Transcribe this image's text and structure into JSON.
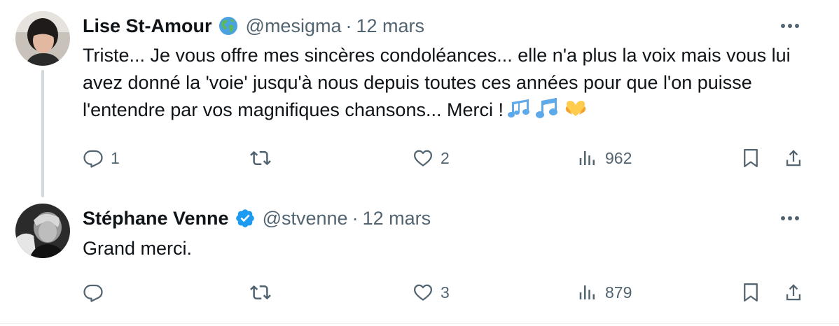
{
  "tweets": [
    {
      "name": "Lise St-Amour",
      "handle": "@mesigma",
      "separator": "·",
      "date": "12 mars",
      "text": "Triste... Je vous offre mes sincères condoléances... elle n'a plus la voix mais vous lui avez donné la 'voie' jusqu'à nous depuis toutes ces années pour que l'on puisse l'entendre par vos magnifiques chansons... Merci !",
      "emojis": [
        "notes-icon",
        "music-note-icon",
        "heart-hands-icon"
      ],
      "badge_icon": "globe-americas-icon",
      "reply_count": "1",
      "retweet_count": "",
      "like_count": "2",
      "view_count": "962"
    },
    {
      "name": "Stéphane Venne",
      "handle": "@stvenne",
      "separator": "·",
      "date": "12 mars",
      "text": "Grand merci.",
      "badge_icon": "verified-badge-icon",
      "reply_count": "",
      "retweet_count": "",
      "like_count": "3",
      "view_count": "879"
    }
  ],
  "colors": {
    "text": "#0f1419",
    "secondary": "#536471",
    "verified": "#1d9bf0",
    "thread_line": "#cfd9de"
  }
}
